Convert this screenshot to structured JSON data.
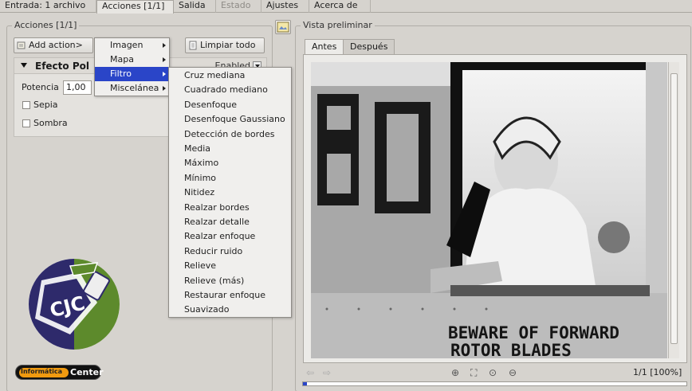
{
  "top_tabs": [
    {
      "label": "Entrada: 1 archivo",
      "state": "normal"
    },
    {
      "label": "Acciones [1/1]",
      "state": "active"
    },
    {
      "label": "Salida",
      "state": "normal"
    },
    {
      "label": "Estado",
      "state": "disabled"
    },
    {
      "label": "Ajustes",
      "state": "normal"
    },
    {
      "label": "Acerca de",
      "state": "normal"
    }
  ],
  "actions": {
    "frame_title": "Acciones [1/1]",
    "add_button": "Add action>",
    "clear_button": "Limpiar todo",
    "effect": {
      "title": "Efecto Pol",
      "enabled_label": "Enabled",
      "potencia_label": "Potencia",
      "potencia_value": "1,00",
      "sepia_label": "Sepia",
      "sombra_label": "Sombra"
    }
  },
  "menu": {
    "items": [
      "Imagen",
      "Mapa",
      "Filtro",
      "Miscelánea"
    ],
    "selected": "Filtro"
  },
  "submenu": {
    "items": [
      "Cruz mediana",
      "Cuadrado mediano",
      "Desenfoque",
      "Desenfoque Gaussiano",
      "Detección de bordes",
      "Media",
      "Máximo",
      "Mínimo",
      "Nitidez",
      "Realzar bordes",
      "Realzar detalle",
      "Realzar enfoque",
      "Reducir ruido",
      "Relieve",
      "Relieve (más)",
      "Restaurar enfoque",
      "Suavizado"
    ]
  },
  "preview": {
    "frame_title": "Vista preliminar",
    "tabs": [
      "Antes",
      "Después"
    ],
    "active_tab": "Antes",
    "image_text": [
      "BEWARE OF FORWARD",
      "ROTOR BLADES"
    ],
    "page_info": "1/1 [100%]",
    "progress": 0.01
  },
  "watermark": {
    "logo_text": "CJC",
    "badge_left": "Informática",
    "badge_right": "Center"
  },
  "colors": {
    "selection": "#2a45c8",
    "window_bg": "#d6d3ce"
  }
}
